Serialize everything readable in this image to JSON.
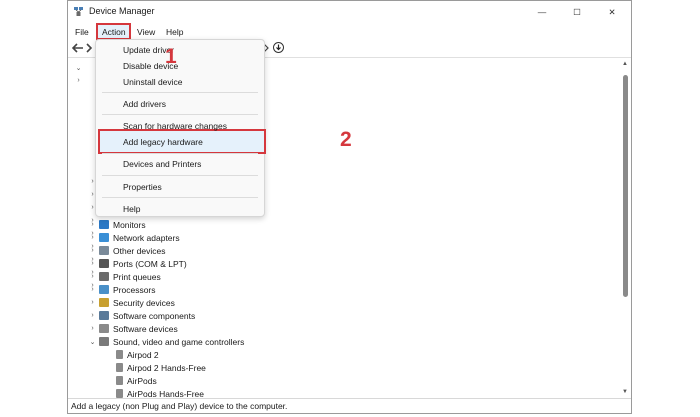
{
  "window": {
    "title": "Device Manager",
    "controls": {
      "minimize": "—",
      "maximize": "☐",
      "close": "✕"
    }
  },
  "menubar": {
    "file": "File",
    "action": "Action",
    "view": "View",
    "help": "Help"
  },
  "action_menu": {
    "items": [
      "Update driver",
      "Disable device",
      "Uninstall device",
      "Add drivers",
      "Scan for hardware changes",
      "Add legacy hardware",
      "Devices and Printers",
      "Properties",
      "Help"
    ]
  },
  "tree": {
    "categories": [
      {
        "label": "Monitors",
        "icon": "monitor-icon",
        "color": "#2b78c5"
      },
      {
        "label": "Network adapters",
        "icon": "network-icon",
        "color": "#3a8fd6"
      },
      {
        "label": "Other devices",
        "icon": "unknown-device-icon",
        "color": "#7a8a99"
      },
      {
        "label": "Ports (COM & LPT)",
        "icon": "port-icon",
        "color": "#555555"
      },
      {
        "label": "Print queues",
        "icon": "printer-icon",
        "color": "#6b6b6b"
      },
      {
        "label": "Processors",
        "icon": "processor-icon",
        "color": "#4a90c8"
      },
      {
        "label": "Security devices",
        "icon": "security-icon",
        "color": "#c8a030"
      },
      {
        "label": "Software components",
        "icon": "software-component-icon",
        "color": "#5a7a99"
      },
      {
        "label": "Software devices",
        "icon": "software-device-icon",
        "color": "#8a8a8a"
      },
      {
        "label": "Sound, video and game controllers",
        "icon": "sound-icon",
        "color": "#7a7a7a"
      }
    ],
    "sound_children": [
      "Airpod 2",
      "Airpod 2 Hands-Free",
      "AirPods",
      "AirPods Hands-Free"
    ]
  },
  "statusbar": {
    "text": "Add a legacy (non Plug and Play) device to the computer."
  },
  "callouts": {
    "one": "1",
    "two": "2"
  },
  "colors": {
    "highlight_red": "#d5373d",
    "menu_bg": "#f9f9f9"
  }
}
